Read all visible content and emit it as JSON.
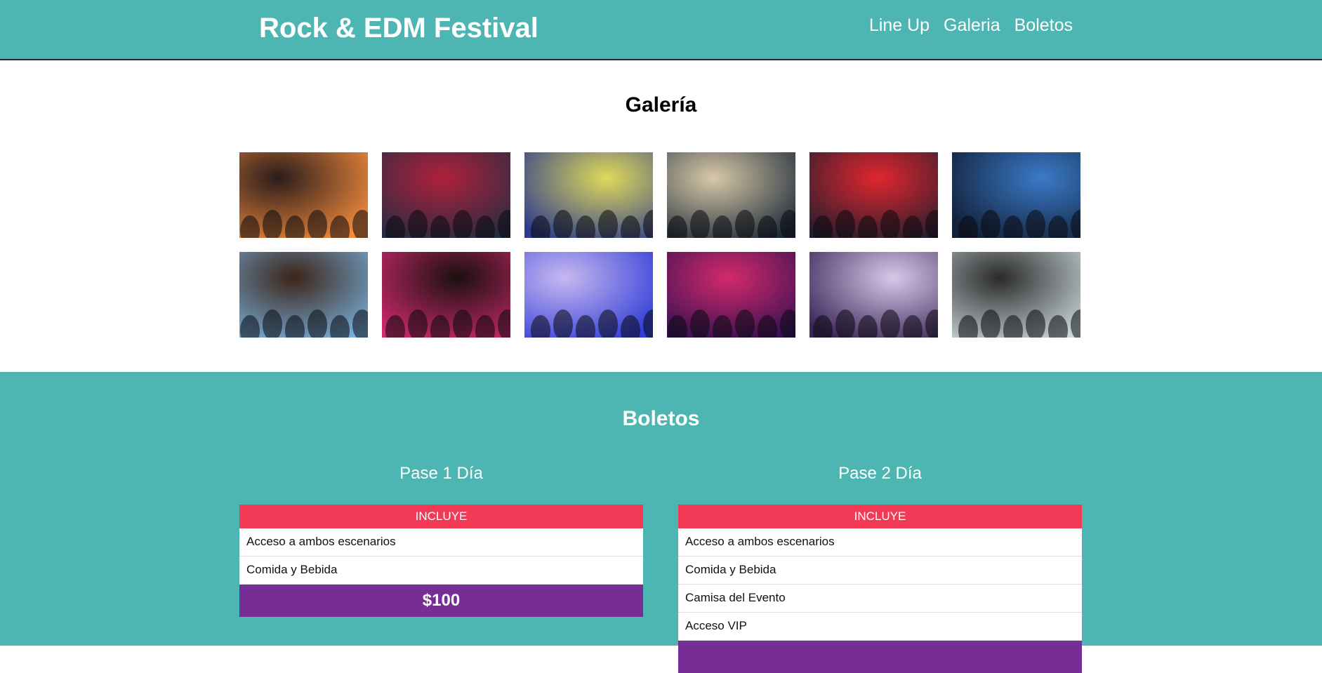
{
  "header": {
    "logo": "Rock & EDM Festival",
    "nav": [
      {
        "label": "Line Up"
      },
      {
        "label": "Galeria"
      },
      {
        "label": "Boletos"
      }
    ]
  },
  "gallery": {
    "title": "Galería",
    "photos": [
      {
        "name": "crowd-concert-photo",
        "colors": [
          "#f08a3c",
          "#2a1c1a"
        ]
      },
      {
        "name": "singer-photo",
        "colors": [
          "#1c2d44",
          "#b0203a"
        ]
      },
      {
        "name": "stage-lights-photo",
        "colors": [
          "#2d3c8c",
          "#e0d95a"
        ]
      },
      {
        "name": "dj-turntable-photo",
        "colors": [
          "#1c2a38",
          "#d8c8a8"
        ]
      },
      {
        "name": "guitarist-red-light-photo",
        "colors": [
          "#1a1d2e",
          "#e0262e"
        ]
      },
      {
        "name": "female-dj-photo",
        "colors": [
          "#12213a",
          "#3a7ac8"
        ]
      },
      {
        "name": "guitar-closeup-photo",
        "colors": [
          "#7ab3e0",
          "#3c2418"
        ]
      },
      {
        "name": "dj-laptop-photo",
        "colors": [
          "#d22a6e",
          "#1a1010"
        ]
      },
      {
        "name": "dj-mixer-blue-photo",
        "colors": [
          "#3340d8",
          "#c8b8f0"
        ]
      },
      {
        "name": "turntable-purple-photo",
        "colors": [
          "#2a0e52",
          "#d22a6a"
        ]
      },
      {
        "name": "band-performers-photo",
        "colors": [
          "#3a2458",
          "#d8c8e8"
        ]
      },
      {
        "name": "performer-smoke-photo",
        "colors": [
          "#c8d4d8",
          "#2a2a2a"
        ]
      }
    ]
  },
  "tickets": {
    "title": "Boletos",
    "passes": [
      {
        "title": "Pase 1 Día",
        "header": "INCLUYE",
        "items": [
          "Acceso a ambos escenarios",
          "Comida y Bebida"
        ],
        "price": "$100"
      },
      {
        "title": "Pase 2 Día",
        "header": "INCLUYE",
        "items": [
          "Acceso a ambos escenarios",
          "Comida y Bebida",
          "Camisa del Evento",
          "Acceso VIP"
        ],
        "price": ""
      }
    ]
  }
}
